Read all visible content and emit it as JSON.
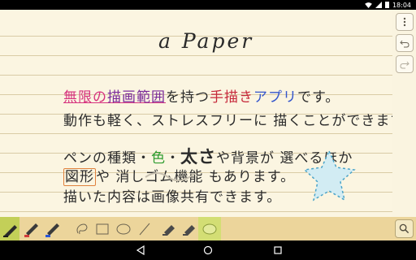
{
  "status_bar": {
    "time": "18:04"
  },
  "paper": {
    "title": "a Paper",
    "lines": [
      {
        "parts": [
          "無限の",
          "描画",
          "範囲",
          "を持つ",
          "手描き",
          "アプリ",
          "です。"
        ]
      },
      {
        "text": "動作も軽く、ストレスフリーに 描くことができます!"
      },
      {
        "parts": [
          "ペンの種類・",
          "色",
          "・",
          "太さ",
          "や背景が 選べるほか"
        ]
      },
      {
        "parts": [
          "図形",
          "や 消しゴム機能",
          " もあります。"
        ]
      },
      {
        "text": "描いた内容は画像共有できます。"
      }
    ]
  },
  "side_buttons": [
    {
      "icon": "more-vert-icon"
    },
    {
      "icon": "undo-icon"
    },
    {
      "icon": "redo-icon"
    }
  ],
  "toolbar": {
    "tools": [
      "pen-black-icon",
      "pen-red-icon",
      "pen-blue-icon",
      "lasso-icon",
      "rectangle-icon",
      "ellipse-icon",
      "line-icon",
      "marker-icon",
      "eraser-icon",
      "fill-shape-icon",
      "search-icon"
    ],
    "accent": "#c3cf58",
    "background": "#ecd59b"
  },
  "nav": [
    "back-icon",
    "home-icon",
    "recents-icon"
  ]
}
